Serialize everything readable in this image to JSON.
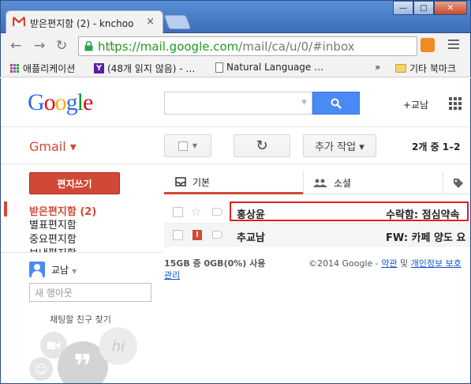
{
  "browser": {
    "tab_title": "받은편지함 (2) - knchoo",
    "tab_close": "×",
    "url_host": "https://mail.google.com",
    "url_path": "/mail/ca/u/0/#inbox",
    "window_buttons": [
      "—",
      "□",
      "✕"
    ],
    "bookmarks": [
      {
        "label": "애플리케이션",
        "icon": "apps-icon"
      },
      {
        "label": "(48개 읽지 않음) - …",
        "icon": "yahoo-icon"
      },
      {
        "label": "Natural Language …",
        "icon": "page-icon"
      },
      {
        "label": "»",
        "icon": "more-icon"
      },
      {
        "label": "기타 북마크",
        "icon": "folder-icon"
      }
    ]
  },
  "header": {
    "logo": "Google",
    "logo_colors": [
      "#3369e8",
      "#d50f25",
      "#eeb211",
      "#3369e8",
      "#009925",
      "#d50f25"
    ],
    "search_placeholder": "",
    "user_link": "+교남"
  },
  "gmail": {
    "label": "Gmail ▾",
    "refresh_icon": "↻",
    "more_actions": "추가 작업 ▾",
    "page_count_prefix": "2개 중 ",
    "page_count_range": "1–2"
  },
  "sidebar": {
    "compose": "편지쓰기",
    "items": [
      {
        "label": "받은편지함 (2)",
        "active": true
      },
      {
        "label": "별표편지함",
        "active": false
      },
      {
        "label": "중요편지함",
        "active": false
      },
      {
        "label": "보낸편지함",
        "active": false
      }
    ]
  },
  "chat": {
    "user_name": "교남",
    "new_hangout_placeholder": "새 행아웃",
    "find_friends": "채팅할 친구 찾기"
  },
  "tabs": [
    {
      "label": "기본",
      "icon": "inbox-icon",
      "active": true
    },
    {
      "label": "소셜",
      "icon": "people-icon",
      "active": false
    },
    {
      "label": "",
      "icon": "tag-icon",
      "active": false
    }
  ],
  "messages": [
    {
      "sender": "홍상윤",
      "subject": "수락함: 점심약속",
      "unread": true,
      "important": false,
      "highlighted": true
    },
    {
      "sender": "추교남",
      "subject": "FW: 카페 양도 요",
      "unread": false,
      "important": true,
      "highlighted": false
    }
  ],
  "footer": {
    "storage": "15GB 중 0GB(0%) 사용",
    "manage": "관리",
    "copyright": "©2014 Google - ",
    "terms": "약관",
    "and": " 및 ",
    "privacy": "개인정보 보호"
  }
}
